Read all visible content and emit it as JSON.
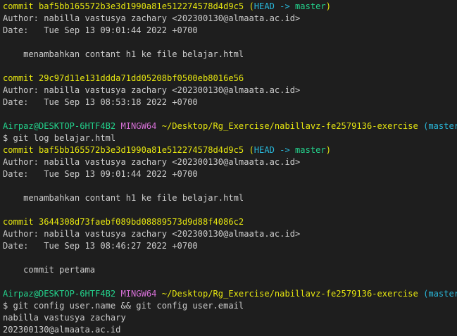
{
  "terminal": {
    "colors": {
      "background": "#1e1e1e",
      "text": "#cccccc",
      "commit_yellow": "#e5e510",
      "prompt_green": "#23d18b",
      "mingw_magenta": "#d670d6",
      "branch_cyan": "#29b8db",
      "head_blue": "#3b8eea"
    },
    "lines": [
      [
        {
          "t": "commit baf5bb165572b3e3d1990a81e512274578d4d9c5 ",
          "c": "c-yellow"
        },
        {
          "t": "(",
          "c": "c-yellow"
        },
        {
          "t": "HEAD -> ",
          "c": "c-cyan"
        },
        {
          "t": "master",
          "c": "c-green"
        },
        {
          "t": ")",
          "c": "c-yellow"
        }
      ],
      [
        {
          "t": "Author: nabilla vastusya zachary <202300130@almaata.ac.id>",
          "c": "c-text"
        }
      ],
      [
        {
          "t": "Date:   Tue Sep 13 09:01:44 2022 +0700",
          "c": "c-text"
        }
      ],
      [
        {
          "t": "",
          "c": "c-text"
        }
      ],
      [
        {
          "t": "    menambahkan contant h1 ke file belajar.html",
          "c": "c-text"
        }
      ],
      [
        {
          "t": "",
          "c": "c-text"
        }
      ],
      [
        {
          "t": "commit 29c97d11e131ddda71dd05208bf0500eb8016e56",
          "c": "c-yellow"
        }
      ],
      [
        {
          "t": "Author: nabilla vastusya zachary <202300130@almaata.ac.id>",
          "c": "c-text"
        }
      ],
      [
        {
          "t": "Date:   Tue Sep 13 08:53:18 2022 +0700",
          "c": "c-text"
        }
      ],
      [
        {
          "t": "",
          "c": "c-text"
        }
      ],
      [
        {
          "t": "Airpaz@DESKTOP-6HTF4B2 ",
          "c": "c-green"
        },
        {
          "t": "MINGW64 ",
          "c": "c-magenta"
        },
        {
          "t": "~/Desktop/Rg_Exercise/nabillavz-fe2579136-exercise ",
          "c": "c-yellow"
        },
        {
          "t": "(master)",
          "c": "c-cyan"
        }
      ],
      [
        {
          "t": "$ git log belajar.html",
          "c": "c-text"
        }
      ],
      [
        {
          "t": "commit baf5bb165572b3e3d1990a81e512274578d4d9c5 ",
          "c": "c-yellow"
        },
        {
          "t": "(",
          "c": "c-yellow"
        },
        {
          "t": "HEAD -> ",
          "c": "c-cyan"
        },
        {
          "t": "master",
          "c": "c-green"
        },
        {
          "t": ")",
          "c": "c-yellow"
        }
      ],
      [
        {
          "t": "Author: nabilla vastusya zachary <202300130@almaata.ac.id>",
          "c": "c-text"
        }
      ],
      [
        {
          "t": "Date:   Tue Sep 13 09:01:44 2022 +0700",
          "c": "c-text"
        }
      ],
      [
        {
          "t": "",
          "c": "c-text"
        }
      ],
      [
        {
          "t": "    menambahkan contant h1 ke file belajar.html",
          "c": "c-text"
        }
      ],
      [
        {
          "t": "",
          "c": "c-text"
        }
      ],
      [
        {
          "t": "commit 3644308d73faebf089bd08889573d9d88f4086c2",
          "c": "c-yellow"
        }
      ],
      [
        {
          "t": "Author: nabilla vastusya zachary <202300130@almaata.ac.id>",
          "c": "c-text"
        }
      ],
      [
        {
          "t": "Date:   Tue Sep 13 08:46:27 2022 +0700",
          "c": "c-text"
        }
      ],
      [
        {
          "t": "",
          "c": "c-text"
        }
      ],
      [
        {
          "t": "    commit pertama",
          "c": "c-text"
        }
      ],
      [
        {
          "t": "",
          "c": "c-text"
        }
      ],
      [
        {
          "t": "Airpaz@DESKTOP-6HTF4B2 ",
          "c": "c-green"
        },
        {
          "t": "MINGW64 ",
          "c": "c-magenta"
        },
        {
          "t": "~/Desktop/Rg_Exercise/nabillavz-fe2579136-exercise ",
          "c": "c-yellow"
        },
        {
          "t": "(master)",
          "c": "c-cyan"
        }
      ],
      [
        {
          "t": "$ git config user.name && git config user.email",
          "c": "c-text"
        }
      ],
      [
        {
          "t": "nabilla vastusya zachary",
          "c": "c-text"
        }
      ],
      [
        {
          "t": "202300130@almaata.ac.id",
          "c": "c-text"
        }
      ]
    ]
  }
}
